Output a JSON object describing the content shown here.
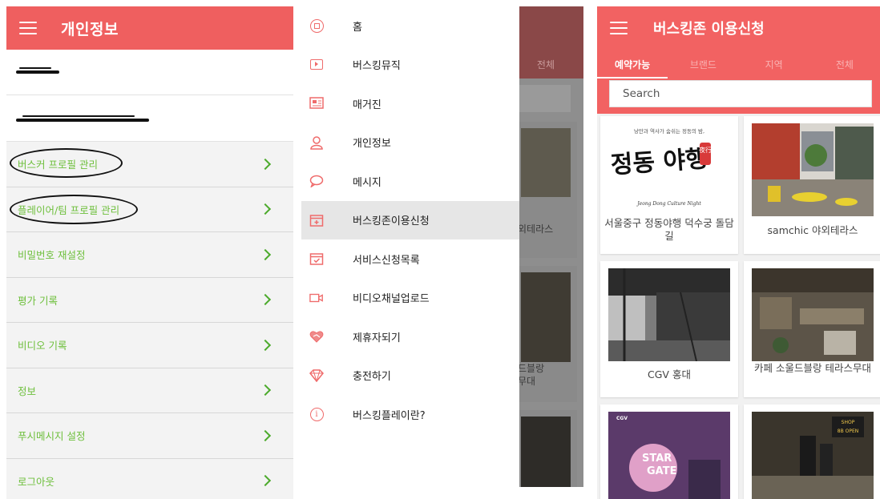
{
  "screen1": {
    "title": "개인정보",
    "menu_items": [
      {
        "label": "버스커 프로필 관리"
      },
      {
        "label": "플레이어/팀 프로필 관리"
      },
      {
        "label": "비밀번호 재설정"
      },
      {
        "label": "평가 기록"
      },
      {
        "label": "비디오 기록"
      },
      {
        "label": "정보"
      },
      {
        "label": "푸시메시지 설정"
      },
      {
        "label": "로그아웃"
      }
    ]
  },
  "screen2": {
    "drawer_items": [
      {
        "label": "홈",
        "icon": "home-circle-icon"
      },
      {
        "label": "버스킹뮤직",
        "icon": "play-box-icon"
      },
      {
        "label": "매거진",
        "icon": "magazine-icon"
      },
      {
        "label": "개인정보",
        "icon": "person-icon"
      },
      {
        "label": "메시지",
        "icon": "chat-bubble-icon"
      },
      {
        "label": "버스킹존이용신청",
        "icon": "calendar-plus-icon"
      },
      {
        "label": "서비스신청목록",
        "icon": "calendar-check-icon"
      },
      {
        "label": "비디오채널업로드",
        "icon": "video-camera-icon"
      },
      {
        "label": "제휴자되기",
        "icon": "heart-handshake-icon"
      },
      {
        "label": "충전하기",
        "icon": "diamond-icon"
      },
      {
        "label": "버스킹플레이란?",
        "icon": "info-icon"
      }
    ],
    "background": {
      "tab_label": "전체",
      "card_texts": [
        "외테라스",
        "드블랑",
        "무대"
      ]
    }
  },
  "screen3": {
    "title": "버스킹존 이용신청",
    "tabs": [
      "예약가능",
      "브랜드",
      "지역",
      "전체"
    ],
    "search_placeholder": "Search",
    "cards": [
      {
        "caption": "서울중구 정동야행 덕수궁 돌담길"
      },
      {
        "caption": "samchic 야외테라스"
      },
      {
        "caption": "CGV 홍대"
      },
      {
        "caption": "카페 소울드블랑 테라스무대"
      }
    ],
    "poster_text": {
      "top_line": "낭만과 역사가 숨쉬는 정동의 밤,",
      "big_text": "정동 야행",
      "stamp": "夜行",
      "romanized": "Jeong Dong Culture Night",
      "cgv_logo": "CGV",
      "star_gate_1": "STAR",
      "star_gate_2": "GATE",
      "sign_text": "8B OPEN",
      "sign_top": "SHOP"
    }
  },
  "colors": {
    "header_red": "#ef5f5f",
    "menu_green": "#6dbf3b",
    "chevron_green": "#4caa2c",
    "icon_red": "#ef6b6b"
  }
}
